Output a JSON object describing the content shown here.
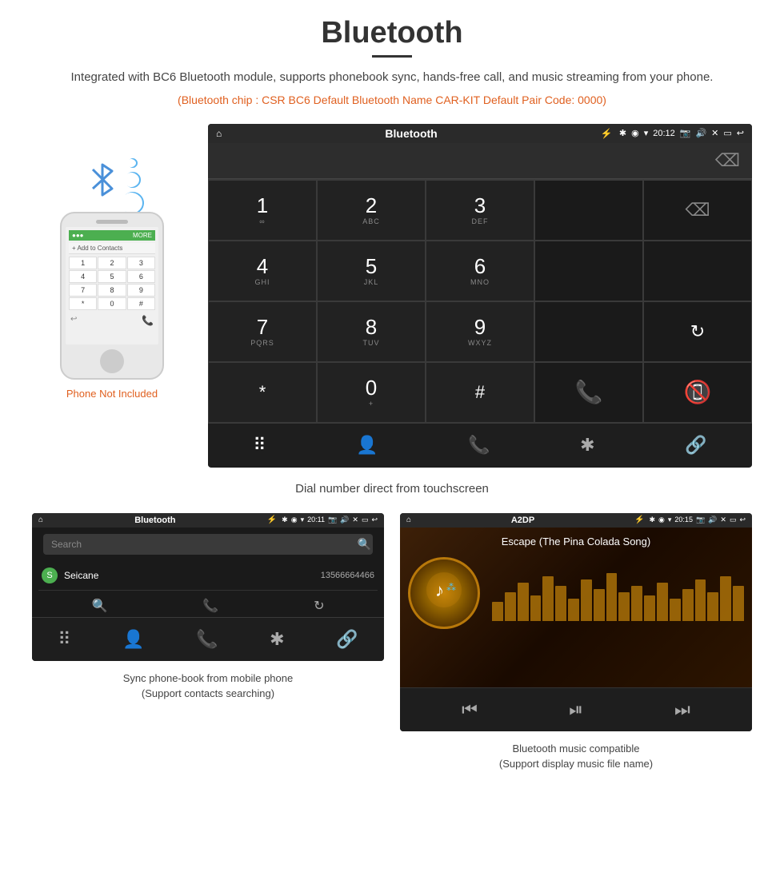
{
  "header": {
    "title": "Bluetooth",
    "underline": true,
    "description": "Integrated with BC6 Bluetooth module, supports phonebook sync, hands-free call, and music streaming from your phone.",
    "specs": "(Bluetooth chip : CSR BC6    Default Bluetooth Name CAR-KIT    Default Pair Code: 0000)"
  },
  "dialer": {
    "status_bar": {
      "home_icon": "⌂",
      "title": "Bluetooth",
      "usb_icon": "⚡",
      "bt_icon": "✱",
      "location_icon": "◉",
      "wifi_icon": "▾",
      "time": "20:12",
      "camera_icon": "📷",
      "volume_icon": "🔊",
      "close_icon": "✕",
      "window_icon": "▭",
      "back_icon": "↩"
    },
    "keys": [
      {
        "num": "1",
        "alpha": "∞"
      },
      {
        "num": "2",
        "alpha": "ABC"
      },
      {
        "num": "3",
        "alpha": "DEF"
      },
      {
        "num": "",
        "alpha": ""
      },
      {
        "num": "⌫",
        "alpha": ""
      },
      {
        "num": "4",
        "alpha": "GHI"
      },
      {
        "num": "5",
        "alpha": "JKL"
      },
      {
        "num": "6",
        "alpha": "MNO"
      },
      {
        "num": "",
        "alpha": ""
      },
      {
        "num": "",
        "alpha": ""
      },
      {
        "num": "7",
        "alpha": "PQRS"
      },
      {
        "num": "8",
        "alpha": "TUV"
      },
      {
        "num": "9",
        "alpha": "WXYZ"
      },
      {
        "num": "",
        "alpha": ""
      },
      {
        "num": "↻",
        "alpha": ""
      },
      {
        "num": "*",
        "alpha": ""
      },
      {
        "num": "0",
        "alpha": "+"
      },
      {
        "num": "#",
        "alpha": ""
      },
      {
        "num": "✆",
        "alpha": ""
      },
      {
        "num": "✆",
        "alpha": ""
      }
    ],
    "toolbar_icons": [
      "⠿",
      "👤",
      "📞",
      "✱",
      "🔗"
    ],
    "caption": "Dial number direct from touchscreen"
  },
  "phone": {
    "label": "Phone Not Included",
    "keypad": [
      "1",
      "2",
      "3",
      "4",
      "5",
      "6",
      "7",
      "8",
      "9",
      "*",
      "0",
      "#"
    ]
  },
  "phonebook": {
    "status_bar": {
      "home_icon": "⌂",
      "title": "Bluetooth",
      "usb_icon": "⚡",
      "bt_icon": "✱",
      "location_icon": "◉",
      "wifi_icon": "▾",
      "time": "20:11",
      "camera_icon": "📷",
      "volume_icon": "🔊",
      "close_icon": "✕",
      "window_icon": "▭",
      "back_icon": "↩"
    },
    "search_placeholder": "Search",
    "contacts": [
      {
        "letter": "S",
        "name": "Seicane",
        "number": "13566664466"
      }
    ],
    "toolbar_icons": [
      "⠿",
      "👤",
      "📞",
      "✱",
      "🔗"
    ],
    "caption_line1": "Sync phone-book from mobile phone",
    "caption_line2": "(Support contacts searching)"
  },
  "music": {
    "status_bar": {
      "home_icon": "⌂",
      "title": "A2DP",
      "usb_icon": "⚡",
      "bt_icon": "✱",
      "location_icon": "◉",
      "wifi_icon": "▾",
      "time": "20:15",
      "camera_icon": "📷",
      "volume_icon": "🔊",
      "close_icon": "✕",
      "window_icon": "▭",
      "back_icon": "↩"
    },
    "song_title": "Escape (The Pina Colada Song)",
    "album_icon": "♪",
    "viz_bars": [
      30,
      45,
      60,
      40,
      70,
      55,
      35,
      65,
      50,
      75,
      45,
      55,
      40,
      60,
      35,
      50,
      65,
      45,
      70,
      55
    ],
    "controls": [
      "⏮",
      "⏯",
      "⏭"
    ],
    "caption_line1": "Bluetooth music compatible",
    "caption_line2": "(Support display music file name)"
  }
}
